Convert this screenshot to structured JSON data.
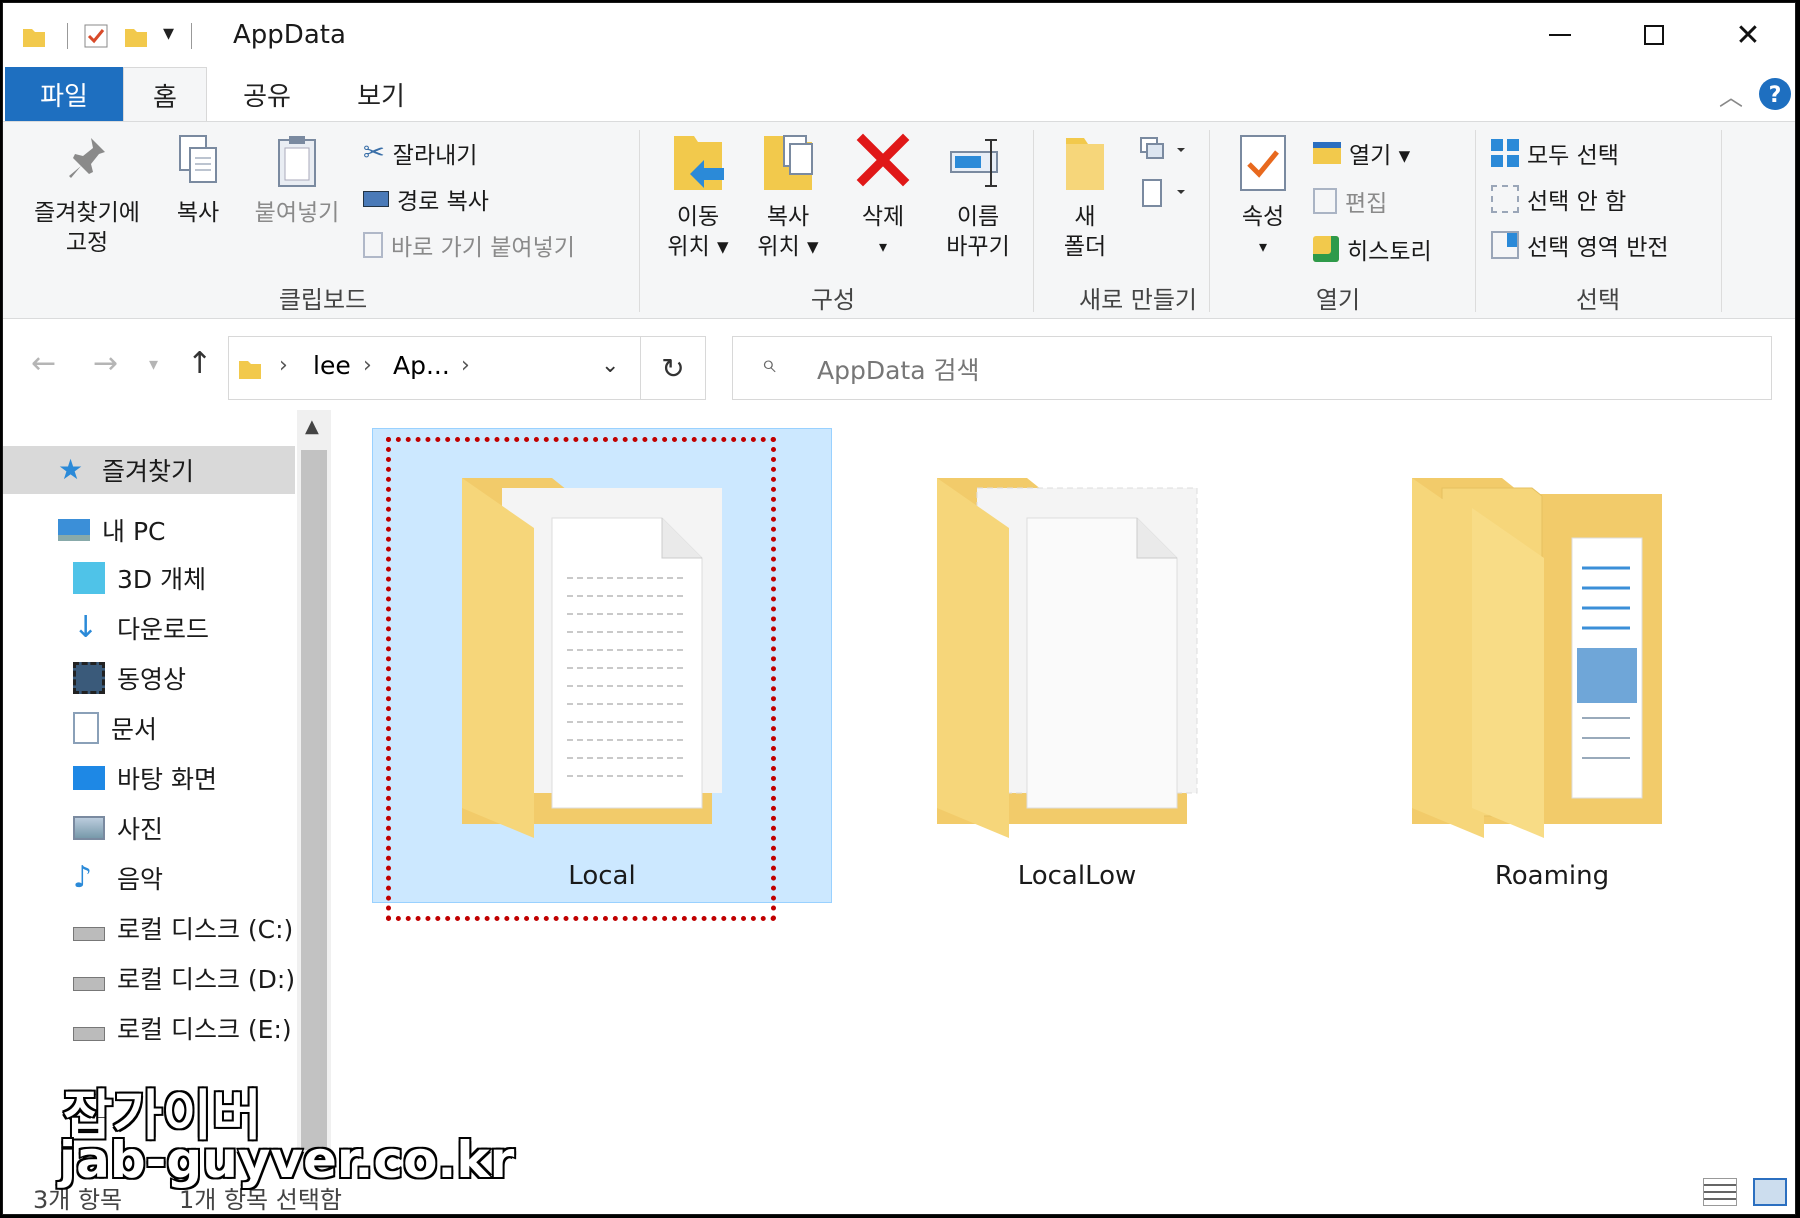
{
  "window": {
    "title": "AppData"
  },
  "tabs": [
    {
      "label": "파일"
    },
    {
      "label": "홈"
    },
    {
      "label": "공유"
    },
    {
      "label": "보기"
    }
  ],
  "ribbon": {
    "pin_line1": "즐겨찾기에",
    "pin_line2": "고정",
    "copy": "복사",
    "paste": "붙여넣기",
    "cut": "잘라내기",
    "copy_path": "경로 복사",
    "paste_shortcut": "바로 가기 붙여넣기",
    "clipboard_group": "클립보드",
    "move_line1": "이동",
    "move_line2": "위치 ▾",
    "copyto_line1": "복사",
    "copyto_line2": "위치 ▾",
    "delete": "삭제",
    "delete_arrow": "▾",
    "rename_line1": "이름",
    "rename_line2": "바꾸기",
    "organize_group": "구성",
    "newfolder_line1": "새",
    "newfolder_line2": "폴더",
    "new_group": "새로 만들기",
    "properties": "속성",
    "properties_arrow": "▾",
    "open": "열기 ▾",
    "edit": "편집",
    "history": "히스토리",
    "open_group": "열기",
    "select_all": "모두 선택",
    "select_none": "선택 안 함",
    "invert_selection": "선택 영역 반전",
    "select_group": "선택"
  },
  "address": {
    "crumbs": [
      "lee",
      "Ap..."
    ],
    "search_placeholder": "AppData 검색"
  },
  "navpane": {
    "quick_access": "즐겨찾기",
    "this_pc": "내 PC",
    "items": [
      "3D 개체",
      "다운로드",
      "동영상",
      "문서",
      "바탕 화면",
      "사진",
      "음악",
      "로컬 디스크 (C:)",
      "로컬 디스크 (D:)",
      "로컬 디스크 (E:)"
    ]
  },
  "folders": [
    {
      "name": "Local",
      "selected": true
    },
    {
      "name": "LocalLow",
      "selected": false
    },
    {
      "name": "Roaming",
      "selected": false
    }
  ],
  "status": {
    "count": "3개 항목",
    "selected": "1개 항목 선택함"
  },
  "watermark": {
    "line1": "잡가이버",
    "line2": "jab-guyver.co.kr"
  },
  "colors": {
    "accent": "#1e6fc0",
    "selection": "#cce8ff",
    "highlight_border": "#c00000",
    "folder": "#f6d67a"
  }
}
